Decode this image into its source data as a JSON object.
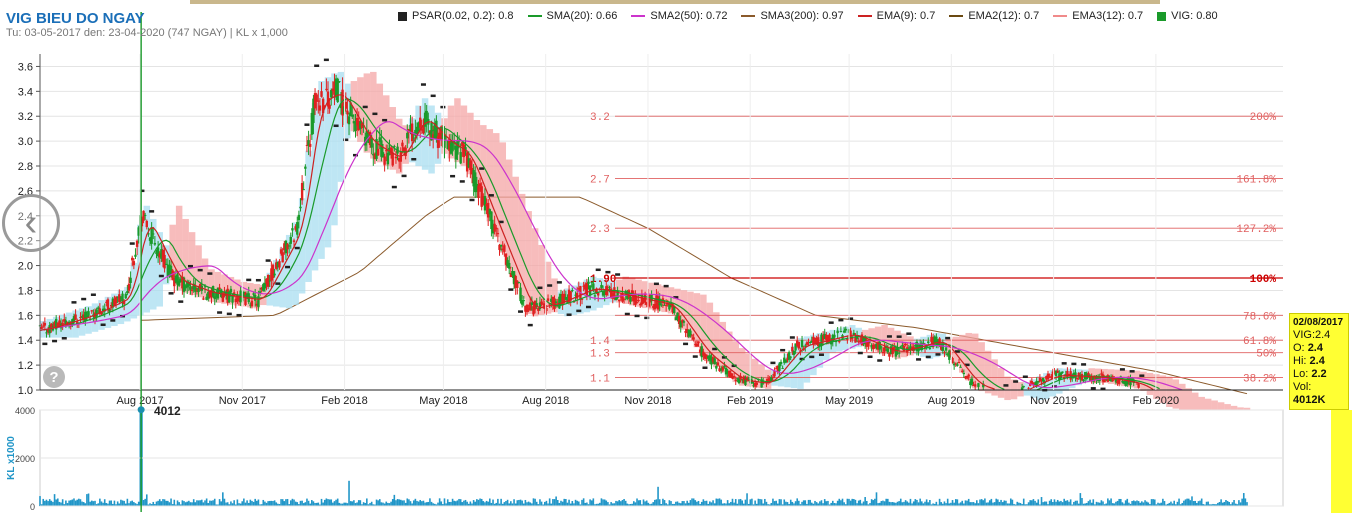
{
  "header": {
    "title": "VIG BIEU DO NGAY",
    "subtitle": "Tu: 03-05-2017 den: 23-04-2020 (747 NGAY) | KL x 1,000"
  },
  "legend": [
    {
      "label": "PSAR(0.02, 0.2): 0.8",
      "color": "#222222",
      "shape": "box"
    },
    {
      "label": "SMA(20): 0.66",
      "color": "#1a9a2a",
      "shape": "line"
    },
    {
      "label": "SMA2(50): 0.72",
      "color": "#cc33cc",
      "shape": "line"
    },
    {
      "label": "SMA3(200): 0.97",
      "color": "#8b5a2b",
      "shape": "line"
    },
    {
      "label": "EMA(9): 0.7",
      "color": "#cc2222",
      "shape": "line"
    },
    {
      "label": "EMA2(12): 0.7",
      "color": "#6b4a12",
      "shape": "line"
    },
    {
      "label": "EMA3(12): 0.7",
      "color": "#f08a8a",
      "shape": "line"
    },
    {
      "label": "VIG: 0.80",
      "color": "#1a9a2a",
      "shape": "box"
    }
  ],
  "tooltip": {
    "date": "02/08/2017",
    "name": "VIG:2.4",
    "open_label": "O:",
    "open": "2.4",
    "high_label": "Hi:",
    "high": "2.4",
    "low_label": "Lo:",
    "low": "2.2",
    "vol_label": "Vol:",
    "vol": "4012K"
  },
  "cursor_volume": "4012",
  "colors": {
    "up": "#1a9a2a",
    "down": "#e02020",
    "volume": "#2196c8",
    "cloud_bull": "#a8ddf0",
    "cloud_bear": "#f4a6a6",
    "fib_line": "#e06060"
  },
  "chart_data": {
    "type": "candlestick",
    "x_range": [
      "2017-05-03",
      "2020-04-23"
    ],
    "sessions": 747,
    "x_tick_labels": [
      "Aug 2017",
      "Nov 2017",
      "Feb 2018",
      "May 2018",
      "Aug 2018",
      "Nov 2018",
      "Feb 2019",
      "May 2019",
      "Aug 2019",
      "Nov 2019",
      "Feb 2020"
    ],
    "x_tick_dates": [
      "2017-08-01",
      "2017-11-01",
      "2018-02-01",
      "2018-05-01",
      "2018-08-01",
      "2018-11-01",
      "2019-02-01",
      "2019-05-01",
      "2019-08-01",
      "2019-11-01",
      "2020-02-01"
    ],
    "price_axis": {
      "ylim": [
        1.0,
        3.7
      ],
      "ticks": [
        "1.0",
        "1.2",
        "1.4",
        "1.6",
        "1.8",
        "2.0",
        "2.2",
        "2.4",
        "2.6",
        "2.8",
        "3.0",
        "3.2",
        "3.4",
        "3.6"
      ]
    },
    "volume_axis": {
      "ylabel": "KL x1000",
      "ylim": [
        0,
        4000
      ],
      "ticks": [
        "0",
        "2000",
        "4000"
      ]
    },
    "price_path": [
      {
        "date": "2017-05-03",
        "close": 1.48
      },
      {
        "date": "2017-06-15",
        "close": 1.6
      },
      {
        "date": "2017-07-20",
        "close": 1.75
      },
      {
        "date": "2017-08-02",
        "close": 2.4
      },
      {
        "date": "2017-09-01",
        "close": 1.88
      },
      {
        "date": "2017-10-01",
        "close": 1.78
      },
      {
        "date": "2017-11-15",
        "close": 1.72
      },
      {
        "date": "2017-12-20",
        "close": 2.3
      },
      {
        "date": "2018-01-05",
        "close": 3.3
      },
      {
        "date": "2018-01-25",
        "close": 3.4
      },
      {
        "date": "2018-02-20",
        "close": 3.0
      },
      {
        "date": "2018-03-20",
        "close": 2.85
      },
      {
        "date": "2018-04-10",
        "close": 3.2
      },
      {
        "date": "2018-05-01",
        "close": 3.0
      },
      {
        "date": "2018-05-20",
        "close": 2.9
      },
      {
        "date": "2018-06-20",
        "close": 2.2
      },
      {
        "date": "2018-07-15",
        "close": 1.65
      },
      {
        "date": "2018-08-10",
        "close": 1.7
      },
      {
        "date": "2018-09-10",
        "close": 1.82
      },
      {
        "date": "2018-10-15",
        "close": 1.75
      },
      {
        "date": "2018-11-20",
        "close": 1.68
      },
      {
        "date": "2018-12-20",
        "close": 1.3
      },
      {
        "date": "2019-01-20",
        "close": 1.08
      },
      {
        "date": "2019-02-15",
        "close": 1.05
      },
      {
        "date": "2019-03-15",
        "close": 1.35
      },
      {
        "date": "2019-05-01",
        "close": 1.45
      },
      {
        "date": "2019-06-10",
        "close": 1.3
      },
      {
        "date": "2019-07-20",
        "close": 1.4
      },
      {
        "date": "2019-08-20",
        "close": 1.05
      },
      {
        "date": "2019-09-20",
        "close": 0.95
      },
      {
        "date": "2019-11-01",
        "close": 1.12
      },
      {
        "date": "2019-12-15",
        "close": 1.1
      },
      {
        "date": "2020-01-15",
        "close": 1.05
      },
      {
        "date": "2020-02-10",
        "close": 0.9
      },
      {
        "date": "2020-03-15",
        "close": 0.82
      },
      {
        "date": "2020-04-23",
        "close": 0.8
      }
    ],
    "sma200_path": [
      {
        "date": "2017-08-02",
        "close": 1.56
      },
      {
        "date": "2017-12-01",
        "close": 1.6
      },
      {
        "date": "2018-02-15",
        "close": 1.95
      },
      {
        "date": "2018-04-15",
        "close": 2.4
      },
      {
        "date": "2018-05-10",
        "close": 2.55
      },
      {
        "date": "2018-09-01",
        "close": 2.55
      },
      {
        "date": "2018-11-01",
        "close": 2.3
      },
      {
        "date": "2019-01-15",
        "close": 1.9
      },
      {
        "date": "2019-04-01",
        "close": 1.6
      },
      {
        "date": "2019-07-01",
        "close": 1.5
      },
      {
        "date": "2019-10-01",
        "close": 1.35
      },
      {
        "date": "2020-02-01",
        "close": 1.15
      },
      {
        "date": "2020-04-23",
        "close": 0.97
      }
    ],
    "fibonacci": [
      {
        "price": 3.2,
        "price_label": "3.2",
        "pct": "200%"
      },
      {
        "price": 2.7,
        "price_label": "2.7",
        "pct": "161.8%"
      },
      {
        "price": 2.3,
        "price_label": "2.3",
        "pct": "127.2%"
      },
      {
        "price": 1.9,
        "price_label": "1.90",
        "pct": "100%",
        "bold": true
      },
      {
        "price": 1.6,
        "price_label": "",
        "pct": "78.6%"
      },
      {
        "price": 1.4,
        "price_label": "1.4",
        "pct": "61.8%"
      },
      {
        "price": 1.3,
        "price_label": "1.3",
        "pct": "50%"
      },
      {
        "price": 1.1,
        "price_label": "1.1",
        "pct": "38.2%"
      }
    ],
    "cursor": {
      "date": "2017-08-02",
      "price": 2.4,
      "volume": 4012
    },
    "volume_spikes": [
      {
        "date": "2017-08-02",
        "volume": 4012
      },
      {
        "date": "2018-02-05",
        "volume": 1050
      },
      {
        "date": "2018-11-10",
        "volume": 800
      },
      {
        "date": "2020-04-20",
        "volume": 540
      }
    ]
  }
}
